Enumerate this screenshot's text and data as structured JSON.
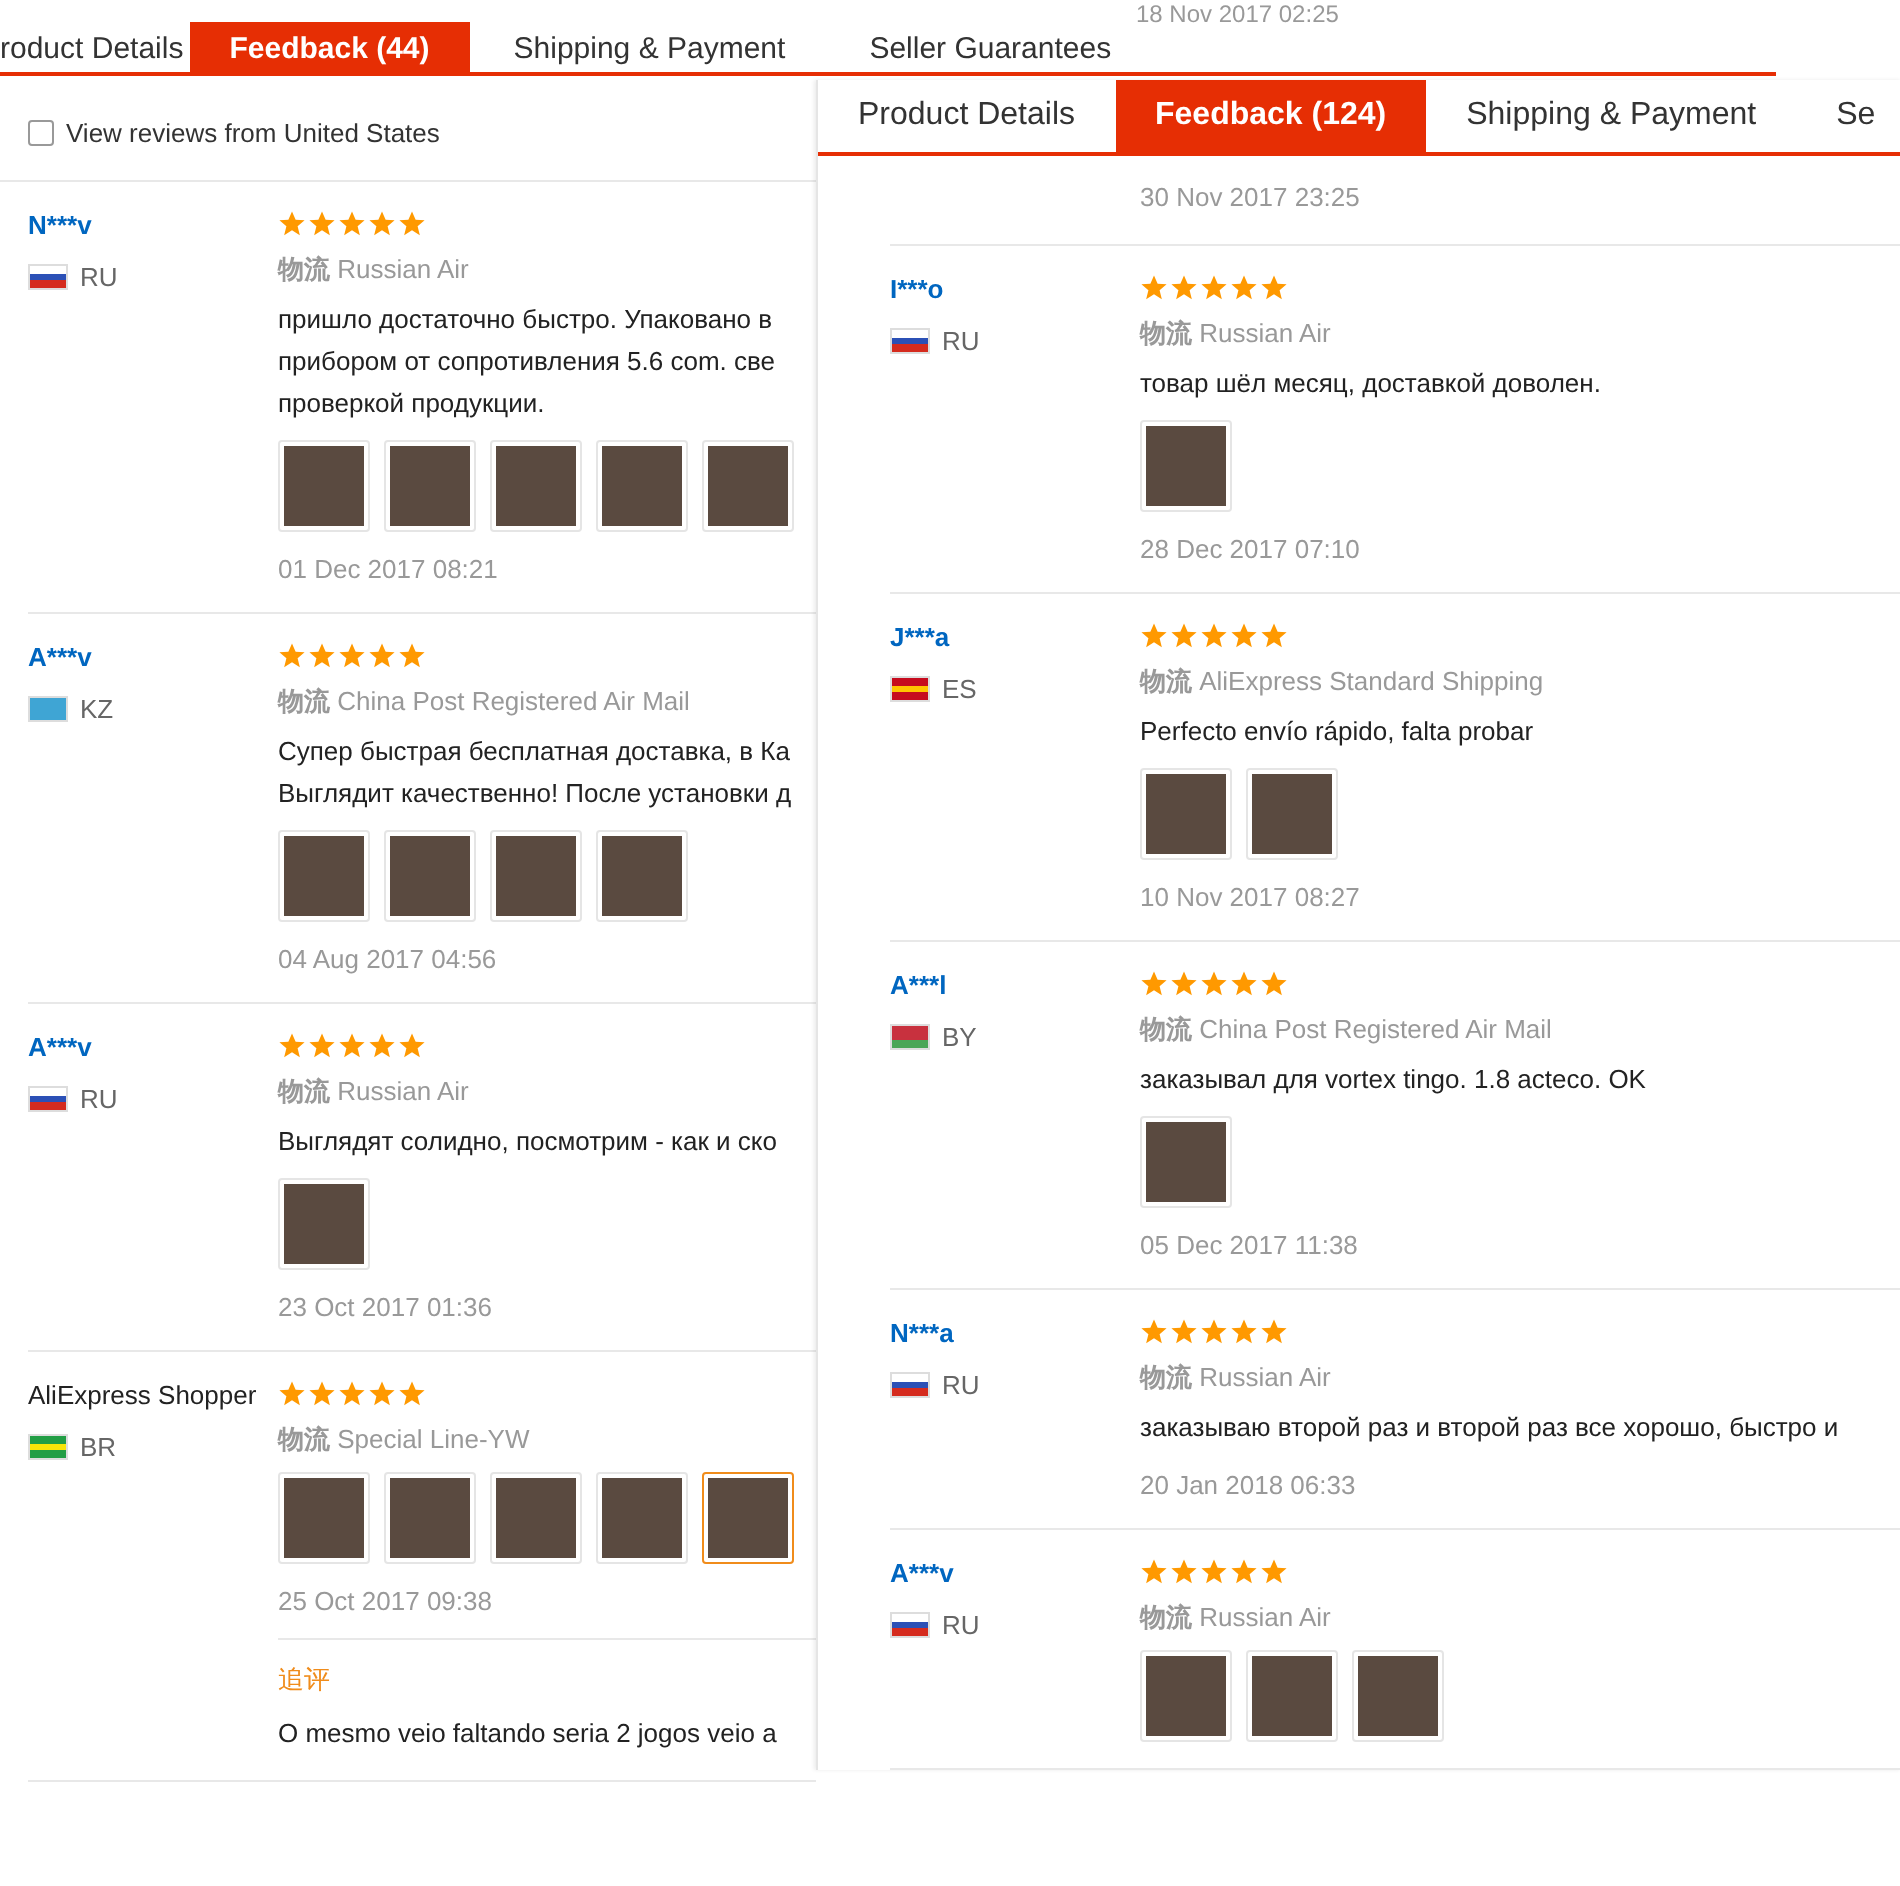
{
  "left_panel": {
    "tabs": [
      {
        "label": "roduct Details",
        "selected": false
      },
      {
        "label": "Feedback (44)",
        "selected": true
      },
      {
        "label": "Shipping & Payment",
        "selected": false
      },
      {
        "label": "Seller Guarantees",
        "selected": false
      }
    ],
    "filter": {
      "label": "View reviews from United States",
      "checked": false
    },
    "reviews": [
      {
        "user": "N***v",
        "linked": true,
        "country": "RU",
        "flag": {
          "kind": "ru"
        },
        "stars": 5,
        "shipping_label": "物流",
        "shipping": "Russian Air",
        "text": [
          "пришло достаточно быстро. Упаковано в",
          "прибором от сопротивления 5.6 com. све",
          "проверкой продукции."
        ],
        "photos": [
          {
            "selected": false
          },
          {
            "selected": false
          },
          {
            "selected": false
          },
          {
            "selected": false
          },
          {
            "selected": false
          }
        ],
        "date": "01 Dec 2017 08:21"
      },
      {
        "user": "A***v",
        "linked": true,
        "country": "KZ",
        "flag": {
          "kind": "kz"
        },
        "stars": 5,
        "shipping_label": "物流",
        "shipping": "China Post Registered Air Mail",
        "text": [
          "Супер быстрая бесплатная доставка, в Ка",
          "Выглядит качественно! После установки д"
        ],
        "photos": [
          {
            "selected": false
          },
          {
            "selected": false
          },
          {
            "selected": false
          },
          {
            "selected": false
          }
        ],
        "date": "04 Aug 2017 04:56"
      },
      {
        "user": "A***v",
        "linked": true,
        "country": "RU",
        "flag": {
          "kind": "ru"
        },
        "stars": 5,
        "shipping_label": "物流",
        "shipping": "Russian Air",
        "text": [
          "Выглядят солидно, посмотрим - как и ско"
        ],
        "photos": [
          {
            "selected": false
          }
        ],
        "date": "23 Oct 2017 01:36"
      },
      {
        "user": "AliExpress Shopper",
        "linked": false,
        "country": "BR",
        "flag": {
          "kind": "br"
        },
        "stars": 5,
        "shipping_label": "物流",
        "shipping": "Special Line-YW",
        "photos": [
          {
            "selected": false
          },
          {
            "selected": false
          },
          {
            "selected": false
          },
          {
            "selected": false
          },
          {
            "selected": true
          }
        ],
        "date": "25 Oct 2017 09:38",
        "followup": {
          "label": "追评",
          "text": "O mesmo veio faltando seria 2 jogos veio a"
        }
      }
    ]
  },
  "overlay_date": "18 Nov 2017 02:25",
  "right_panel": {
    "tabs": [
      {
        "label": "Product Details",
        "selected": false
      },
      {
        "label": "Feedback (124)",
        "selected": true
      },
      {
        "label": "Shipping & Payment",
        "selected": false
      },
      {
        "label": "Se",
        "selected": false
      }
    ],
    "previous_date": "30 Nov 2017 23:25",
    "reviews": [
      {
        "user": "I***o",
        "linked": true,
        "country": "RU",
        "flag": {
          "kind": "ru"
        },
        "stars": 5,
        "shipping_label": "物流",
        "shipping": "Russian Air",
        "text": [
          "товар шёл месяц, доставкой доволен."
        ],
        "photos": [
          {
            "selected": false
          }
        ],
        "date": "28 Dec 2017 07:10"
      },
      {
        "user": "J***a",
        "linked": true,
        "country": "ES",
        "flag": {
          "kind": "es"
        },
        "stars": 5,
        "shipping_label": "物流",
        "shipping": "AliExpress Standard Shipping",
        "text": [
          "Perfecto envío rápido, falta probar"
        ],
        "photos": [
          {
            "selected": false
          },
          {
            "selected": false
          }
        ],
        "date": "10 Nov 2017 08:27"
      },
      {
        "user": "A***l",
        "linked": true,
        "country": "BY",
        "flag": {
          "kind": "by"
        },
        "stars": 5,
        "shipping_label": "物流",
        "shipping": "China Post Registered Air Mail",
        "text": [
          "заказывал для vortex tingo. 1.8 acteco. OK"
        ],
        "photos": [
          {
            "selected": false
          }
        ],
        "date": "05 Dec 2017 11:38"
      },
      {
        "user": "N***a",
        "linked": true,
        "country": "RU",
        "flag": {
          "kind": "ru"
        },
        "stars": 5,
        "shipping_label": "物流",
        "shipping": "Russian Air",
        "text": [
          "заказываю второй раз и второй раз все хорошо, быстро и"
        ],
        "date": "20 Jan 2018 06:33"
      },
      {
        "user": "A***v",
        "linked": true,
        "country": "RU",
        "flag": {
          "kind": "ru"
        },
        "stars": 5,
        "shipping_label": "物流",
        "shipping": "Russian Air",
        "photos": [
          {
            "selected": false
          },
          {
            "selected": false
          },
          {
            "selected": false
          }
        ]
      }
    ]
  }
}
